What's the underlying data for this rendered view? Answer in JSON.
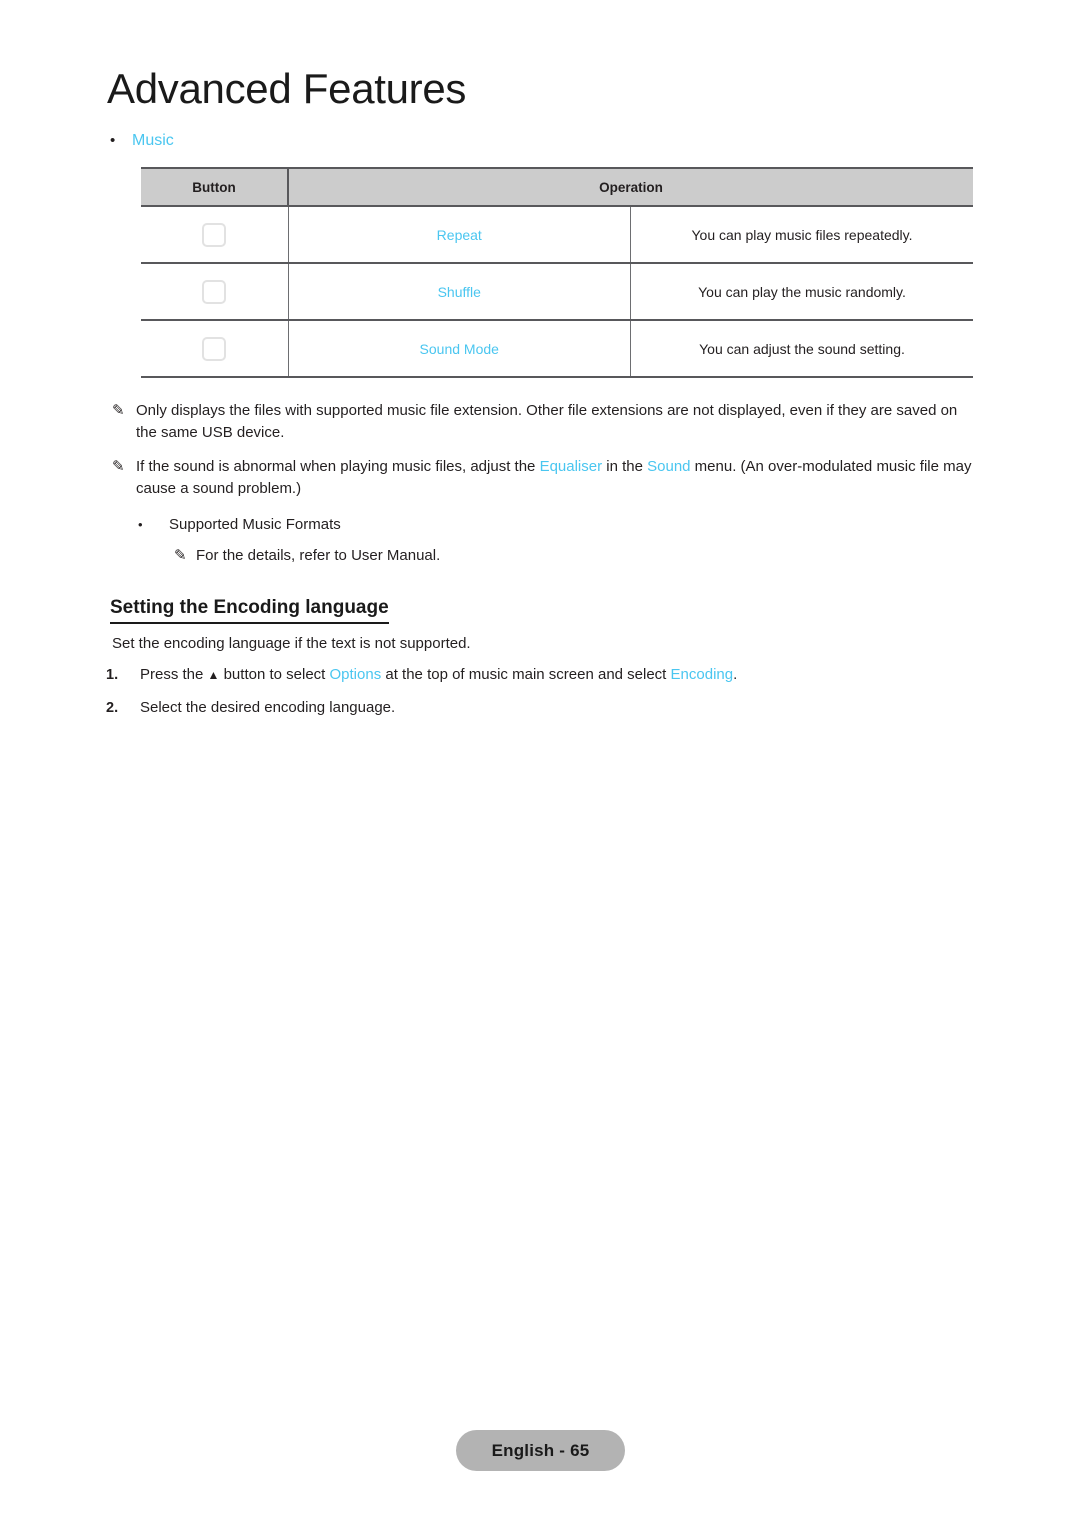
{
  "page": {
    "chapter_title": "Advanced Features",
    "accent_color": "#4ac6f0",
    "text_color": "#231f20",
    "header_bg": "#cccccc",
    "footer_bg": "#b3b3b3"
  },
  "section": {
    "bullet_glyph": "•",
    "label": "Music"
  },
  "table": {
    "headers": {
      "button": "Button",
      "operation": "Operation"
    },
    "rows": [
      {
        "icon": "key-button-glyph",
        "label": "Repeat",
        "description": "You can play music files repeatedly."
      },
      {
        "icon": "key-button-glyph",
        "label": "Shuffle",
        "description": "You can play the music randomly."
      },
      {
        "icon": "key-button-glyph",
        "label": "Sound Mode",
        "description": "You can adjust the sound setting."
      }
    ]
  },
  "notes": {
    "pencil_glyph": "✎",
    "note_1": "Only displays the files with supported music file extension. Other file extensions are not displayed, even if they are saved on the same USB device.",
    "note_2_part_1": "If the sound is abnormal when playing music files, adjust the ",
    "note_2_link_1": "Equaliser",
    "note_2_part_2": " in the ",
    "note_2_link_2": "Sound",
    "note_2_part_3": " menu. (An over-modulated music file may cause a sound problem.)",
    "sub_bullet_glyph": "•",
    "sub_bullet_label": "Supported Music Formats",
    "sub_note": "For the details, refer to User Manual."
  },
  "encoding_section": {
    "heading": "Setting the Encoding language",
    "intro": "Set the encoding language if the text is not supported.",
    "steps": [
      {
        "number": "1.",
        "part_1": "Press the ",
        "triangle": "▲",
        "part_2": " button to select ",
        "link_1": "Options",
        "part_3": " at the top of music main screen and select ",
        "link_2": "Encoding",
        "part_4": "."
      },
      {
        "number": "2.",
        "part_1": "Select the desired encoding language.",
        "triangle": "",
        "part_2": "",
        "link_1": "",
        "part_3": "",
        "link_2": "",
        "part_4": ""
      }
    ]
  },
  "footer": {
    "page_label": "English - 65"
  }
}
